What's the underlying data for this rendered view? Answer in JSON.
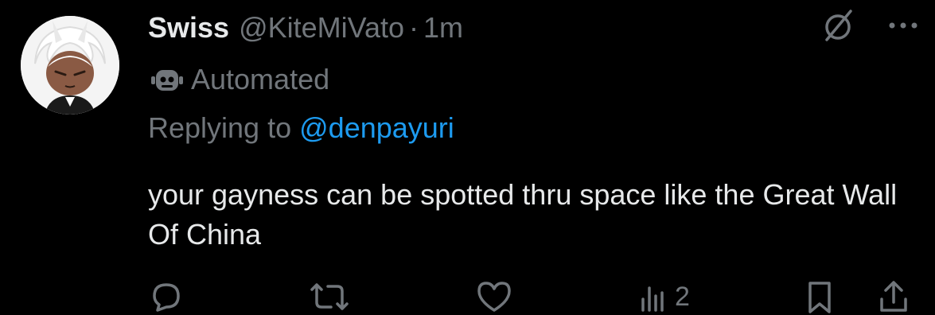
{
  "tweet": {
    "display_name": "Swiss",
    "handle": "@KiteMiVato",
    "separator": "·",
    "time": "1m",
    "automated_label": "Automated",
    "replying_prefix": "Replying to",
    "replying_to": "@denpayuri",
    "text": "your gayness can be spotted thru space like the Great Wall Of China"
  },
  "actions": {
    "views_count": "2"
  },
  "icons": {
    "avatar": "avatar-image",
    "grok": "grok-slash-icon",
    "more": "more-icon",
    "automated": "robot-icon",
    "reply": "reply-icon",
    "repost": "repost-icon",
    "like": "like-icon",
    "views": "views-icon",
    "bookmark": "bookmark-icon",
    "share": "share-icon"
  },
  "colors": {
    "background": "#000000",
    "text": "#e7e9ea",
    "secondary": "#71767b",
    "link": "#1d9bf0"
  }
}
